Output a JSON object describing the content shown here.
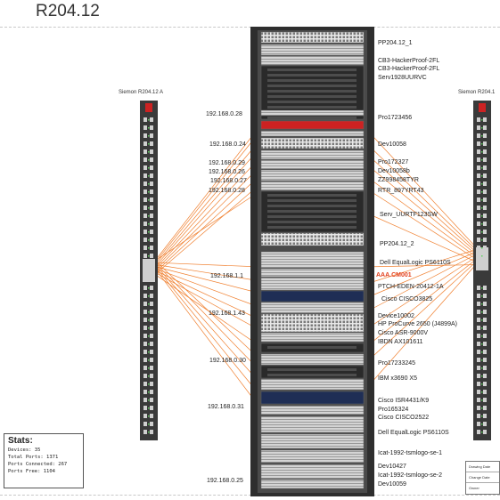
{
  "title": "R204.12",
  "pdu_left": {
    "label": "Siemon R204.12 A"
  },
  "pdu_right": {
    "label": "Siemon R204.1"
  },
  "device_labels": [
    {
      "text": "PP204.12_1",
      "highlight": false
    },
    {
      "text": "CB3-HackerProof-2FL",
      "highlight": false
    },
    {
      "text": "CB3-HackerProof-2FL",
      "highlight": false
    },
    {
      "text": "Serv1928UURVC",
      "highlight": false
    },
    {
      "text": "Pro1723456",
      "highlight": false
    },
    {
      "text": "Dev10058",
      "highlight": false
    },
    {
      "text": "Pro172327",
      "highlight": false
    },
    {
      "text": "Dev10058b",
      "highlight": false
    },
    {
      "text": "ZZ998458TYR",
      "highlight": false
    },
    {
      "text": "RTR_897YRT43",
      "highlight": false
    },
    {
      "text": "Serv_UURTF123SW",
      "highlight": false
    },
    {
      "text": "PP204.12_2",
      "highlight": false
    },
    {
      "text": "Dell EqualLogic PS6110S",
      "highlight": false
    },
    {
      "text": "AAA.CM001",
      "highlight": true
    },
    {
      "text": "PTCH-EDEN-20412-1A",
      "highlight": false
    },
    {
      "text": "Cisco CISCO3825",
      "highlight": false
    },
    {
      "text": "Device10002",
      "highlight": false
    },
    {
      "text": "HP ProCurve 2650 (J4899A)",
      "highlight": false
    },
    {
      "text": "Cisco ASR-9000V",
      "highlight": false
    },
    {
      "text": "IBDN AX101611",
      "highlight": false
    },
    {
      "text": "Pro17233245",
      "highlight": false
    },
    {
      "text": "IBM x3690 X5",
      "highlight": false
    },
    {
      "text": "Cisco ISR4431/K9",
      "highlight": false
    },
    {
      "text": "Pro165324",
      "highlight": false
    },
    {
      "text": "Cisco CISCO2522",
      "highlight": false
    },
    {
      "text": "Dell EqualLogic PS6110S",
      "highlight": false
    },
    {
      "text": "Icat-1992-tsmlogo-se-1",
      "highlight": false
    },
    {
      "text": "Dev10427",
      "highlight": false
    },
    {
      "text": "Icat-1992-tsmlogo-se-2",
      "highlight": false
    },
    {
      "text": "Dev10059",
      "highlight": false
    }
  ],
  "ip_labels": [
    "192.168.0.28",
    "192.168.0.24",
    "192.168.0.29",
    "192.168.0.26",
    "192.168.0.27",
    "192.168.0.28",
    "192.168.1.1",
    "192.168.1.43",
    "192.168.0.30",
    "192.168.0.31",
    "192.168.0.25"
  ],
  "stats": {
    "heading": "Stats:",
    "devices": "Devices: 35",
    "total_ports": "Total Ports: 1371",
    "ports_connected": "Ports Connected: 267",
    "ports_free": "Ports Free: 1104"
  },
  "title_block": {
    "drawing_date": "Drawing Date",
    "change_date": "Change Date",
    "owner": "Owner"
  },
  "colors": {
    "cable": "#f08030",
    "highlight_device": "#cc2222",
    "rack": "#333333",
    "pdu": "#3a3a3a"
  }
}
